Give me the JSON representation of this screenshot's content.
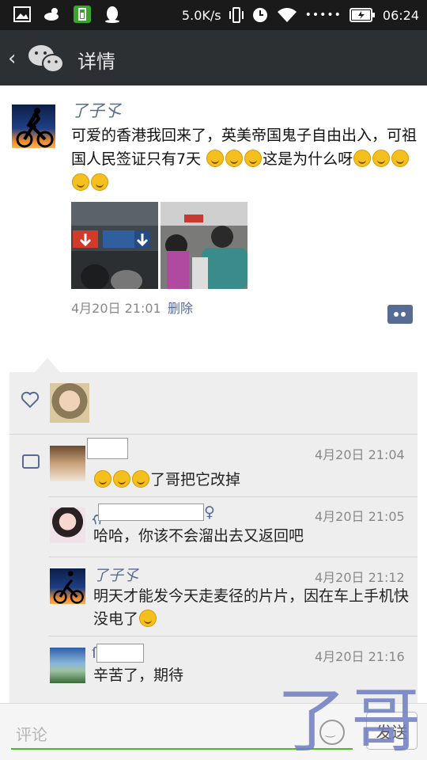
{
  "status_bar": {
    "net_speed": "5.0K/s",
    "signal": "•••••",
    "time": "06:24"
  },
  "header": {
    "back_icon": "chevron-left-icon",
    "app_icon": "wechat-icon",
    "title": "详情"
  },
  "post": {
    "author": "了子孓",
    "text_1": "可爱的香港我回来了，英美帝国鬼子自由出入，可祖国人民签证只有7天",
    "text_2": "这是为什么呀",
    "time": "4月20日 21:01",
    "delete_label": "删除"
  },
  "comments": [
    {
      "time": "4月20日 21:04",
      "text": "了哥把它改掉"
    },
    {
      "name_prefix": "ᡣ",
      "name_suffix": "♀",
      "time": "4月20日 21:05",
      "text": "哈哈，你该不会溜出去又返回吧"
    },
    {
      "name": "了子孓",
      "time": "4月20日 21:12",
      "text": "明天才能发今天走麦径的片片，因在车上手机快没电了"
    },
    {
      "name_prefix": "ſ",
      "time": "4月20日 21:16",
      "text": "辛苦了，期待"
    }
  ],
  "input": {
    "placeholder": "评论",
    "send_label": "发送"
  },
  "watermark": "了哥",
  "colors": {
    "link": "#576b95",
    "accent_green": "#45c01a",
    "titlebar": "#2d3033"
  }
}
